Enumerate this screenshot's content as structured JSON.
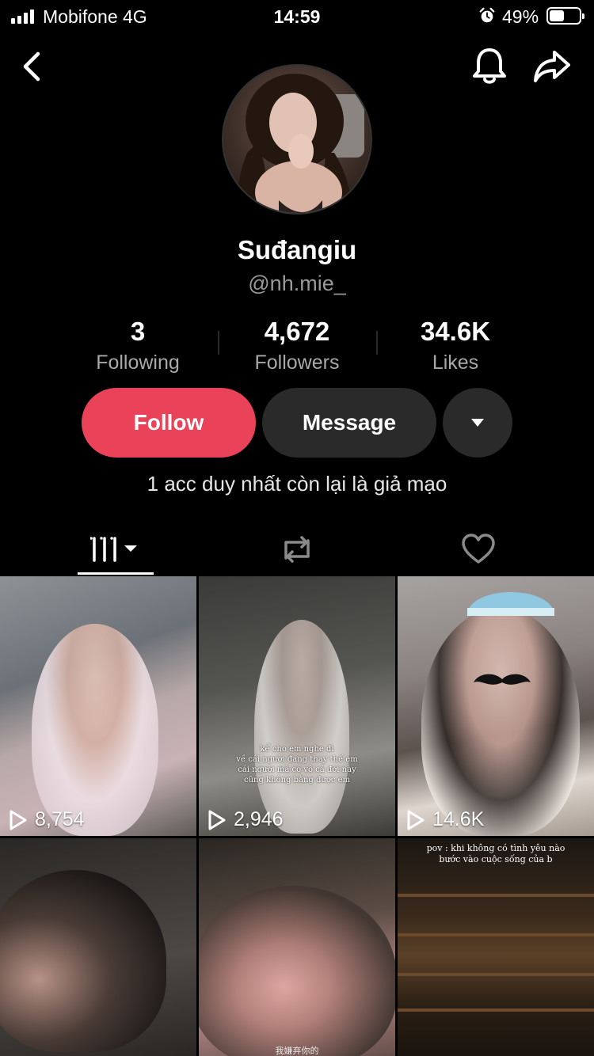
{
  "status_bar": {
    "carrier": "Mobifone  4G",
    "time": "14:59",
    "battery_percent": "49%",
    "battery_level": 0.49,
    "alarm_icon": "alarm-clock-icon"
  },
  "nav": {
    "back_icon": "chevron-left-icon",
    "bell_icon": "bell-icon",
    "share_icon": "share-arrow-icon"
  },
  "profile": {
    "display_name": "Suđangiu",
    "username": "@nh.mie_",
    "bio": "1 acc duy nhất còn lại là giả mạo"
  },
  "stats": [
    {
      "value": "3",
      "label": "Following"
    },
    {
      "value": "4,672",
      "label": "Followers"
    },
    {
      "value": "34.6K",
      "label": "Likes"
    }
  ],
  "actions": {
    "follow_label": "Follow",
    "message_label": "Message"
  },
  "tabs": {
    "videos_icon": "video-grid-icon",
    "repost_icon": "repost-icon",
    "liked_icon": "heart-icon",
    "active": "videos"
  },
  "videos": [
    {
      "views": "8,754"
    },
    {
      "views": "2,946",
      "caption": "kể cho em nghe đi\nvề cái người đang thay thế em\ncái người mà có vô cả đời này\ncũng không bằng được em"
    },
    {
      "views": "14.6K"
    },
    {},
    {
      "caption": "我嫌弃你的"
    },
    {
      "caption": "pov : khi không có tình yêu nào\nbước vào cuộc sống của b"
    }
  ],
  "colors": {
    "background": "#000000",
    "follow_button": "#ea4259",
    "secondary_button": "#2a2a2a",
    "muted_text": "#9a9a9a"
  }
}
